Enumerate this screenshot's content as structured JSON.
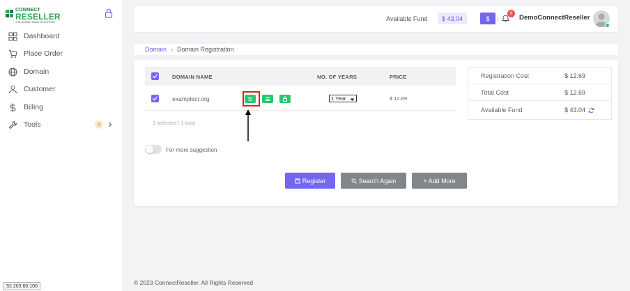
{
  "brand": {
    "line1": "CONNECT",
    "line2": "RESELLER",
    "tagline": "THE DOMAIN NAME REGISTRAR"
  },
  "sidebar": {
    "items": [
      {
        "label": "Dashboard",
        "icon": "grid-icon"
      },
      {
        "label": "Place Order",
        "icon": "cart-icon"
      },
      {
        "label": "Domain",
        "icon": "globe-icon"
      },
      {
        "label": "Customer",
        "icon": "user-icon"
      },
      {
        "label": "Billing",
        "icon": "dollar-icon"
      },
      {
        "label": "Tools",
        "icon": "wrench-icon",
        "badge": "9"
      }
    ]
  },
  "header": {
    "fund_label": "Available Fund",
    "fund_value": "$ 43.04",
    "dollar_button": "$",
    "notification_count": "0",
    "username": "DemoConnectReseller"
  },
  "breadcrumb": {
    "link": "Domain",
    "current": "Domain Registration"
  },
  "table": {
    "headers": [
      "DOMAIN NAME",
      "NO. OF YEARS",
      "PRICE"
    ],
    "rows": [
      {
        "domain": "examplecr.org",
        "years": "1 Year",
        "price": "$ 12.69",
        "checked": true
      }
    ],
    "selected_info": "1 selected / 1 total"
  },
  "suggestion": {
    "label": "For more suggestion",
    "enabled": false
  },
  "buttons": {
    "register": "Register",
    "search_again": "Search Again",
    "add_more": "+ Add More"
  },
  "summary": {
    "rows": [
      {
        "label": "Registration Cost",
        "value": "$ 12.69"
      },
      {
        "label": "Total Cost",
        "value": "$ 12.69"
      },
      {
        "label": "Available Fund",
        "value": "$ 43.04"
      }
    ]
  },
  "footer": "© 2023 ConnectReseller. All Rights Reserved",
  "ip": "52.203.60.100",
  "colors": {
    "primary": "#7367f0",
    "success": "#28c76f",
    "secondary": "#82868b",
    "danger": "#ea5455",
    "highlight": "#e02020"
  }
}
